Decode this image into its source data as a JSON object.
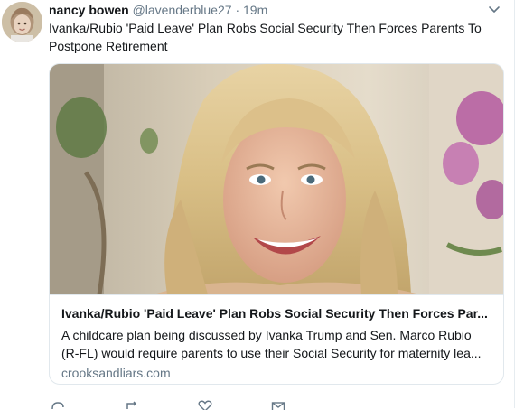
{
  "tweet": {
    "author_name": "nancy bowen",
    "author_handle": "@lavenderblue27",
    "separator": "·",
    "time": "19m",
    "text": "Ivanka/Rubio 'Paid Leave' Plan Robs Social Security Then Forces Parents To Postpone Retirement"
  },
  "card": {
    "title": "Ivanka/Rubio 'Paid Leave' Plan Robs Social Security Then Forces Par...",
    "description_line1": "A childcare plan being discussed by Ivanka Trump and Sen. Marco Rubio",
    "description_line2": "(R-FL) would require parents to use their Social Security for maternity lea...",
    "domain": "crooksandliars.com"
  },
  "icons": [
    "more-caret-icon",
    "reply-icon",
    "retweet-icon",
    "like-icon",
    "direct-message-icon"
  ],
  "colors": {
    "text": "#14171a",
    "secondary": "#657786",
    "border": "#e1e8ed"
  }
}
